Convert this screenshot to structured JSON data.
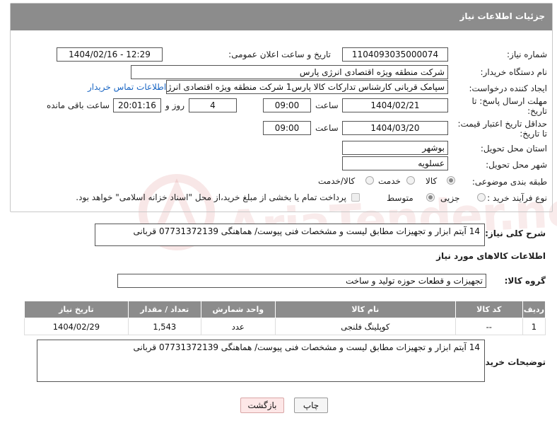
{
  "header": {
    "title": "جزئیات اطلاعات نیاز"
  },
  "watermark": {
    "text": "AriaTender.neT"
  },
  "form": {
    "need_number": {
      "label": "شماره نیاز:",
      "value": "1104093035000074"
    },
    "announce": {
      "label": "تاریخ و ساعت اعلان عمومی:",
      "value": "1404/02/16 - 12:29"
    },
    "buyer_org": {
      "label": "نام دستگاه خریدار:",
      "value": "شرکت منطقه ویژه اقتصادی انرژی پارس"
    },
    "creator": {
      "label": "ایجاد کننده درخواست:",
      "value": "سپامک قربانی کارشناس تدارکات کالا پارس1 شرکت منطقه ویژه اقتصادی انرژی",
      "contact_link": "اطلاعات تماس خریدار"
    },
    "deadline": {
      "label_line1": "مهلت ارسال پاسخ: تا",
      "label_line2": "تاریخ:",
      "date": "1404/02/21",
      "time_label": "ساعت",
      "time": "09:00",
      "days": "4",
      "days_label": "روز و",
      "remaining": "20:01:16",
      "remaining_label": "ساعت باقی مانده"
    },
    "price_validity": {
      "label_line1": "حداقل تاریخ اعتبار قیمت:",
      "label_line2": "تا تاریخ:",
      "date": "1404/03/20",
      "time_label": "ساعت",
      "time": "09:00"
    },
    "province": {
      "label": "استان محل تحویل:",
      "value": "بوشهر"
    },
    "city": {
      "label": "شهر محل تحویل:",
      "value": "عسلویه"
    },
    "category": {
      "label": "طبقه بندی موضوعی:",
      "options": [
        "کالا",
        "خدمت",
        "کالا/خدمت"
      ],
      "selected": "کالا"
    },
    "process": {
      "label": "نوع فرآیند خرید :",
      "options": [
        "جزیی",
        "متوسط"
      ],
      "selected": "متوسط",
      "payment_note": "پرداخت تمام یا بخشی از مبلغ خرید،از محل \"اسناد خزانه اسلامی\" خواهد بود."
    }
  },
  "summary": {
    "label": "شرح کلی نیاز:",
    "text": "14 آیتم ابزار و تجهیزات مطابق لیست و مشخصات فنی پیوست/ هماهنگی 07731372139 قربانی"
  },
  "goods_section": {
    "title": "اطلاعات کالاهای مورد نیاز"
  },
  "goods_group": {
    "label": "گروه کالا:",
    "value": "تجهیزات و قطعات حوزه تولید و ساخت"
  },
  "table": {
    "headers": [
      "ردیف",
      "کد کالا",
      "نام کالا",
      "واحد شمارش",
      "تعداد / مقدار",
      "تاریخ نیاز"
    ],
    "rows": [
      {
        "row": "1",
        "code": "--",
        "name": "کوپلینگ فلنجی",
        "unit": "عدد",
        "qty": "1,543",
        "date": "1404/02/29"
      }
    ]
  },
  "buyer_notes": {
    "label": "توضیحات خریدار:",
    "text": "14 آیتم ابزار و تجهیزات مطابق لیست و مشخصات فنی پیوست/ هماهنگی 07731372139 قربانی"
  },
  "buttons": {
    "print": "چاپ",
    "back": "بازگشت"
  }
}
